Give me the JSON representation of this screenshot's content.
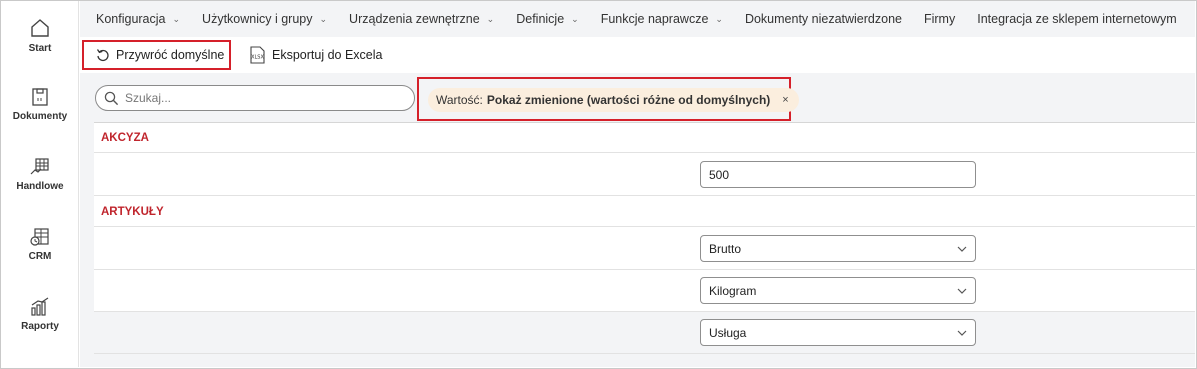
{
  "rail": {
    "items": [
      {
        "label": "Start",
        "icon": "home-icon"
      },
      {
        "label": "Dokumenty",
        "icon": "document-icon"
      },
      {
        "label": "Handlowe",
        "icon": "trade-icon"
      },
      {
        "label": "CRM",
        "icon": "crm-icon"
      },
      {
        "label": "Raporty",
        "icon": "reports-icon"
      }
    ]
  },
  "topnav": {
    "items": [
      {
        "label": "Konfiguracja",
        "dropdown": true
      },
      {
        "label": "Użytkownicy i grupy",
        "dropdown": true
      },
      {
        "label": "Urządzenia zewnętrzne",
        "dropdown": true
      },
      {
        "label": "Definicje",
        "dropdown": true
      },
      {
        "label": "Funkcje naprawcze",
        "dropdown": true
      },
      {
        "label": "Dokumenty niezatwierdzone",
        "dropdown": false
      },
      {
        "label": "Firmy",
        "dropdown": false
      },
      {
        "label": "Integracja ze sklepem internetowym",
        "dropdown": false
      }
    ]
  },
  "toolbar": {
    "restore_label": "Przywróć domyślne",
    "export_label": "Eksportuj do Excela",
    "export_icon_text": "XLSX"
  },
  "search": {
    "placeholder": "Szukaj..."
  },
  "filter": {
    "prefix": "Wartość:",
    "value": "Pokaż zmienione (wartości różne od domyślnych)",
    "close": "×"
  },
  "sections": [
    {
      "title": "AKCYZA",
      "rows": [
        {
          "value": "500",
          "type": "input"
        }
      ]
    },
    {
      "title": "ARTYKUŁY",
      "rows": [
        {
          "value": "Brutto",
          "type": "select"
        },
        {
          "value": "Kilogram",
          "type": "select"
        },
        {
          "value": "Usługa",
          "type": "select"
        }
      ]
    }
  ],
  "colors": {
    "accent": "#c0252d",
    "highlight_border": "#d5202a",
    "chip_bg": "#fbeede"
  }
}
